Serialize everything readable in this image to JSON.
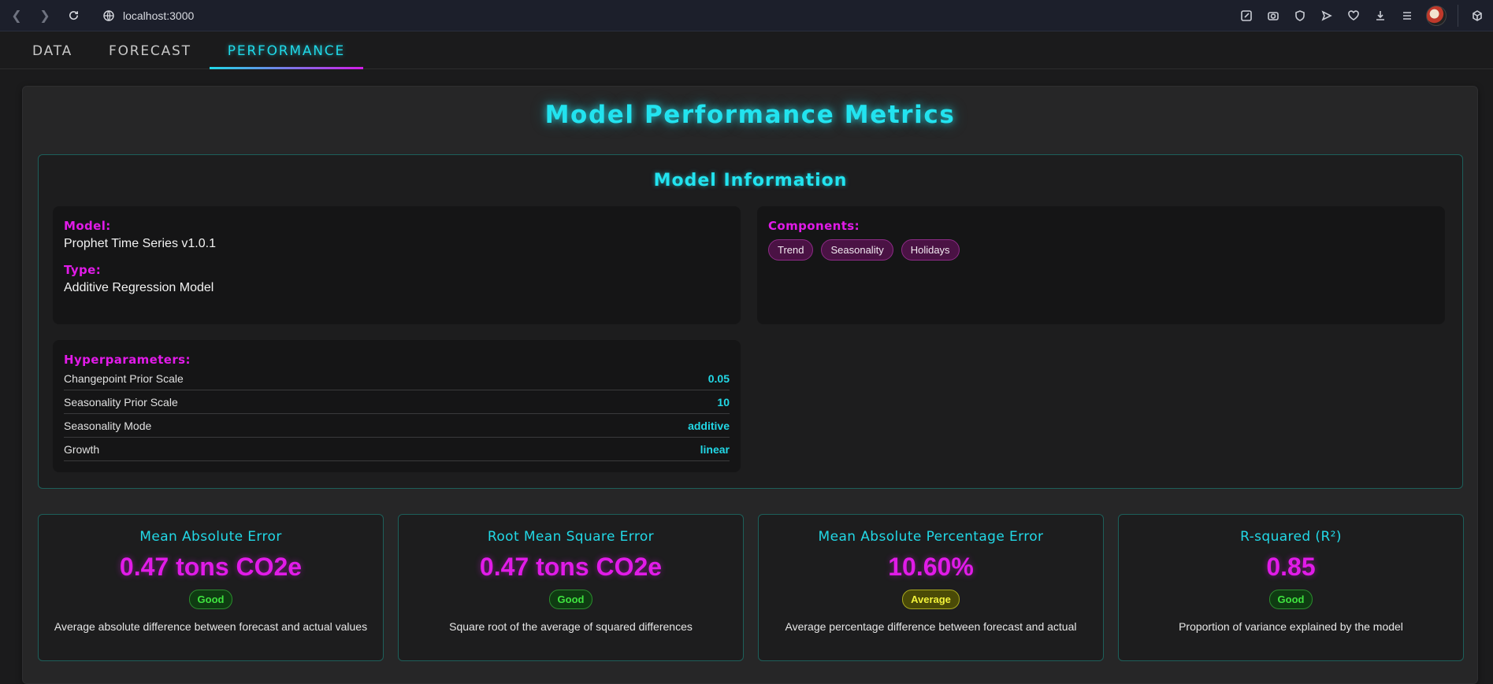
{
  "browser": {
    "url": "localhost:3000"
  },
  "tabs": [
    {
      "label": "DATA"
    },
    {
      "label": "FORECAST"
    },
    {
      "label": "PERFORMANCE"
    }
  ],
  "page": {
    "title": "Model Performance Metrics"
  },
  "model_info": {
    "title": "Model Information",
    "model_label": "Model:",
    "model_value": "Prophet Time Series v1.0.1",
    "type_label": "Type:",
    "type_value": "Additive Regression Model",
    "components_label": "Components:",
    "components": [
      "Trend",
      "Seasonality",
      "Holidays"
    ],
    "hyper_label": "Hyperparameters:",
    "hyperparameters": [
      {
        "name": "Changepoint Prior Scale",
        "value": "0.05"
      },
      {
        "name": "Seasonality Prior Scale",
        "value": "10"
      },
      {
        "name": "Seasonality Mode",
        "value": "additive"
      },
      {
        "name": "Growth",
        "value": "linear"
      }
    ]
  },
  "metrics": [
    {
      "name": "Mean Absolute Error",
      "value": "0.47 tons CO2e",
      "rating": "Good",
      "description": "Average absolute difference between forecast and actual values"
    },
    {
      "name": "Root Mean Square Error",
      "value": "0.47 tons CO2e",
      "rating": "Good",
      "description": "Square root of the average of squared differences"
    },
    {
      "name": "Mean Absolute Percentage Error",
      "value": "10.60%",
      "rating": "Average",
      "description": "Average percentage difference between forecast and actual"
    },
    {
      "name": "R-squared (R²)",
      "value": "0.85",
      "rating": "Good",
      "description": "Proportion of variance explained by the model"
    }
  ],
  "colors": {
    "accent_cyan": "#22e3ef",
    "accent_magenta": "#e11be8",
    "good": "#3fe43f",
    "average": "#f2f23a"
  }
}
